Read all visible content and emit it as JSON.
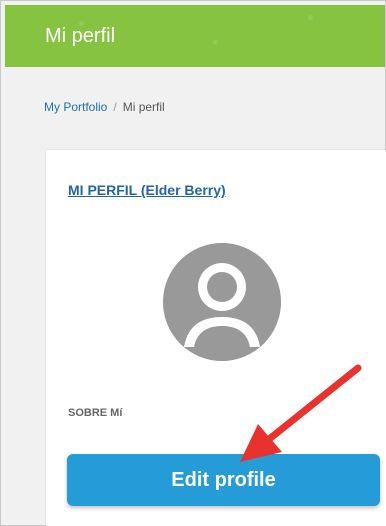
{
  "header": {
    "title": "Mi perfil",
    "bg_color": "#86c341"
  },
  "breadcrumb": {
    "home": "My Portfolio",
    "separator": "/",
    "current": "Mi perfil"
  },
  "profile_card": {
    "title": "MI PERFIL (Elder Berry)",
    "avatar_icon": "default-user-avatar",
    "about_label": "SOBRE Mí",
    "edit_button_label": "Edit profile",
    "button_color": "#259bd8"
  },
  "annotation": {
    "arrow_color": "#e8322e"
  }
}
